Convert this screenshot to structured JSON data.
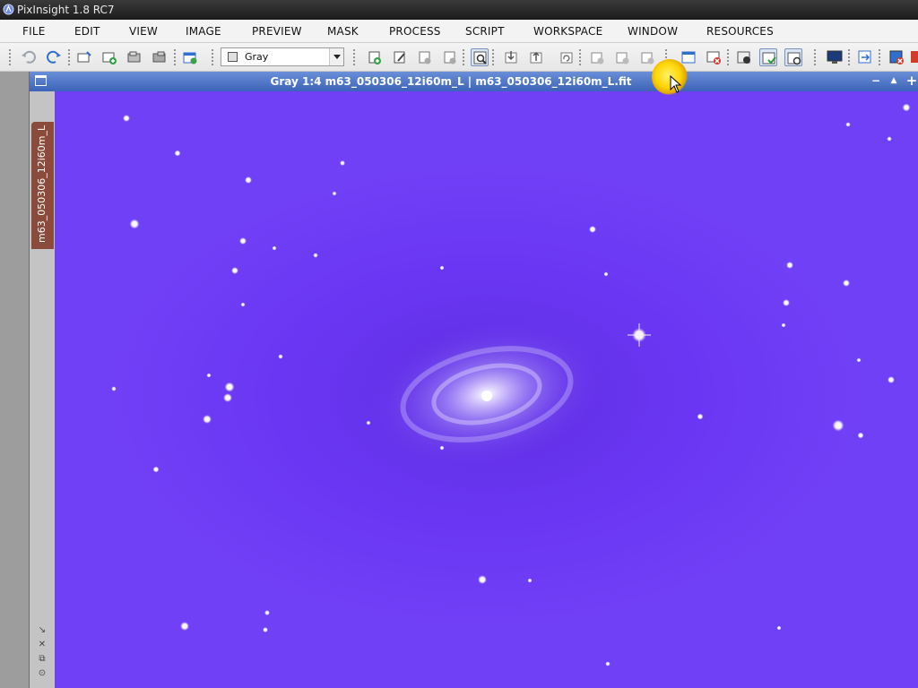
{
  "app": {
    "title": "PixInsight 1.8 RC7"
  },
  "menu": {
    "items": [
      {
        "label": "FILE"
      },
      {
        "label": "EDIT"
      },
      {
        "label": "VIEW"
      },
      {
        "label": "IMAGE"
      },
      {
        "label": "PREVIEW"
      },
      {
        "label": "MASK"
      },
      {
        "label": "PROCESS"
      },
      {
        "label": "SCRIPT"
      },
      {
        "label": "WORKSPACE"
      },
      {
        "label": "WINDOW"
      },
      {
        "label": "RESOURCES"
      }
    ]
  },
  "toolbar": {
    "channel_select": {
      "value": "Gray"
    }
  },
  "image_window": {
    "title": "Gray 1:4 m63_050306_12i60m_L | m63_050306_12i60m_L.fit",
    "view_tab": "m63_050306_12i60m_L",
    "minimize_glyph": "−",
    "shade_glyph": "▲",
    "maximize_glyph": "+"
  },
  "colors": {
    "image_background": "#6b38f4",
    "window_titlebar": "#4a72c6",
    "view_tab": "#8a4b3a",
    "cursor_highlight": "#ffd400"
  },
  "icons": [
    "undo-icon",
    "redo-icon",
    "new-image-icon",
    "new-window-icon",
    "duplicate-icon",
    "new-preview-icon",
    "edit-preview-icon",
    "add-preview-icon",
    "delete-preview-icon",
    "zoom-icon",
    "readout-icon",
    "mask-icon",
    "stf-icon",
    "monitor-icon",
    "close-all-icon"
  ]
}
